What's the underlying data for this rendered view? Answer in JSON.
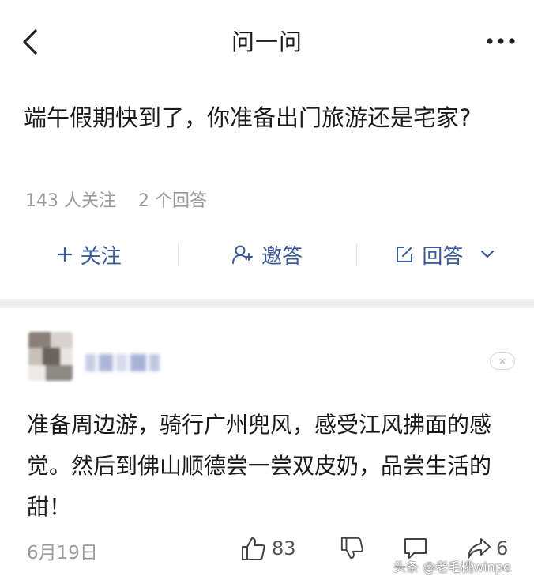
{
  "header": {
    "back_icon": "chevron-left-icon",
    "title": "问一问",
    "more_icon": "more-horizontal-icon"
  },
  "question": {
    "title": "端午假期快到了，你准备出门旅游还是宅家?",
    "followers": "143 人关注",
    "answers": "2 个回答"
  },
  "actions": {
    "follow_label": "关注",
    "invite_label": "邀答",
    "answer_label": "回答"
  },
  "answer": {
    "text": "准备周边游，骑行广州兜风，感受江风拂面的感觉。然后到佛山顺德尝一尝双皮奶，品尝生活的甜！",
    "date": "6月19日",
    "likes": "83",
    "shares": "6"
  },
  "watermark": "头条 @老毛桃winpe",
  "colors": {
    "accent": "#3a5a9a",
    "muted": "#9a9a9a",
    "divider": "#eeeeee"
  }
}
